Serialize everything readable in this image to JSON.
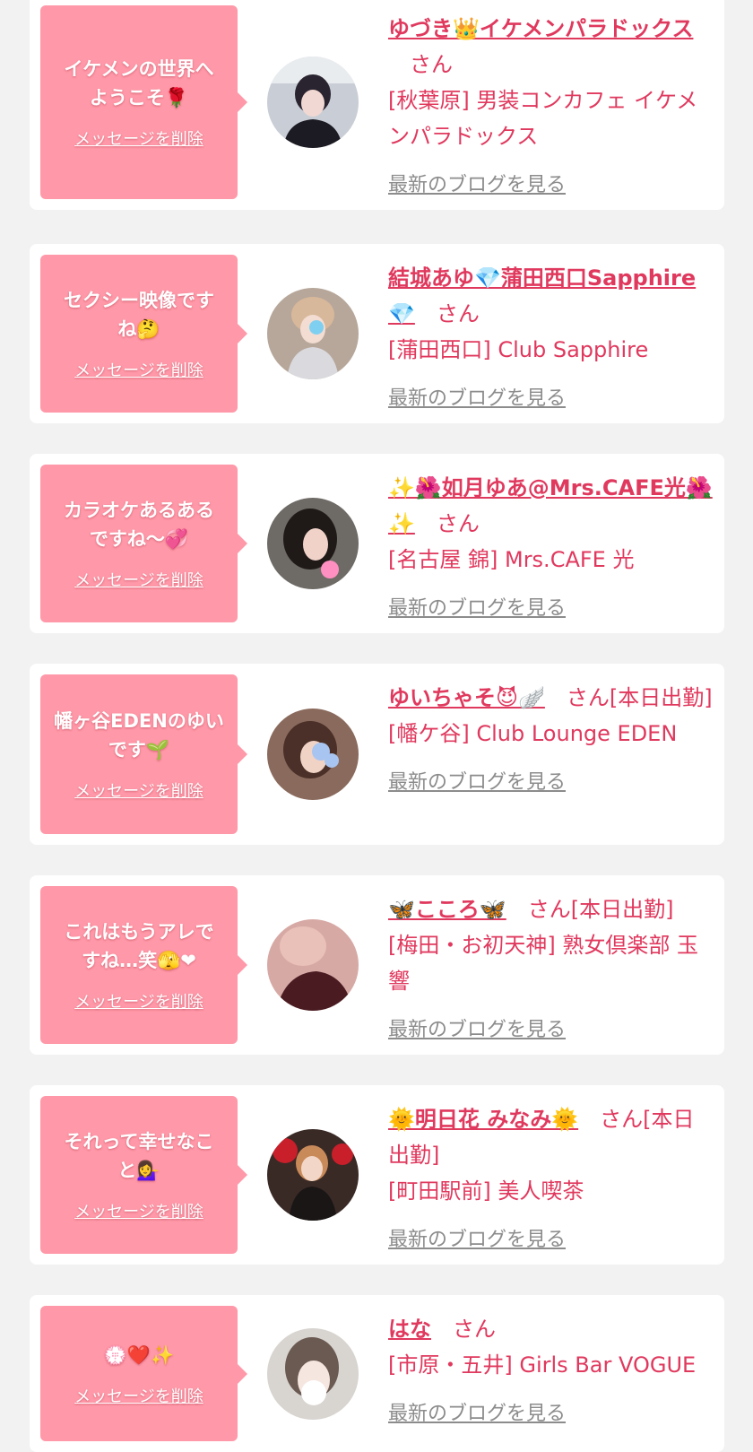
{
  "colors": {
    "background": "#f2f2f2",
    "card": "#ffffff",
    "bubble": "#ff98a8",
    "accent": "#e0395e",
    "link_gray": "#8c8c8c"
  },
  "messages": [
    {
      "bubble_lines": [
        "イケメンの世界へ",
        "ようこそ🌹"
      ],
      "delete_label": "メッセージを削除",
      "name": "ゆづき👑イケメンパラドックス",
      "honorific": "さん",
      "shop": "[秋葉原] 男装コンカフェ イケメンパラドックス",
      "blog_label": "最新のブログを見る",
      "avatar_icon": "avatar-photo"
    },
    {
      "bubble_lines": [
        "セクシー映像です",
        "ね🤔"
      ],
      "delete_label": "メッセージを削除",
      "name": "結城あゆ💎蒲田西口Sapphire💎",
      "honorific": "さん",
      "shop": "[蒲田西口] Club Sapphire",
      "blog_label": "最新のブログを見る",
      "avatar_icon": "avatar-photo"
    },
    {
      "bubble_lines": [
        "カラオケあるある",
        "ですね〜💞"
      ],
      "delete_label": "メッセージを削除",
      "name": "✨🌺如月ゆあ@Mrs.CAFE光🌺✨",
      "honorific": "さん",
      "shop": "[名古屋 錦] Mrs.CAFE 光",
      "blog_label": "最新のブログを見る",
      "avatar_icon": "avatar-photo"
    },
    {
      "bubble_lines": [
        "幡ヶ谷EDENのゆい",
        "です🌱"
      ],
      "delete_label": "メッセージを削除",
      "name": "ゆいちゃそ😈🪽",
      "honorific": "さん[本日出勤]",
      "shop": "[幡ケ谷] Club Lounge EDEN",
      "blog_label": "最新のブログを見る",
      "avatar_icon": "avatar-photo"
    },
    {
      "bubble_lines": [
        "これはもうアレで",
        "すね…笑🫣❤"
      ],
      "delete_label": "メッセージを削除",
      "name": "🦋こころ🦋",
      "honorific": "さん[本日出勤]",
      "shop": "[梅田・お初天神] 熟女倶楽部 玉響",
      "blog_label": "最新のブログを見る",
      "avatar_icon": "avatar-photo"
    },
    {
      "bubble_lines": [
        "それって幸せなこ",
        "と💁‍♀️"
      ],
      "delete_label": "メッセージを削除",
      "name": "🌞明日花 みなみ🌞",
      "honorific": "さん[本日出勤]",
      "shop": "[町田駅前] 美人喫茶",
      "blog_label": "最新のブログを見る",
      "avatar_icon": "avatar-photo"
    },
    {
      "bubble_lines": [
        "💮❤️✨"
      ],
      "delete_label": "メッセージを削除",
      "name": "はな",
      "honorific": "さん",
      "shop": "[市原・五井] Girls Bar VOGUE",
      "blog_label": "最新のブログを見る",
      "avatar_icon": "avatar-photo"
    }
  ]
}
